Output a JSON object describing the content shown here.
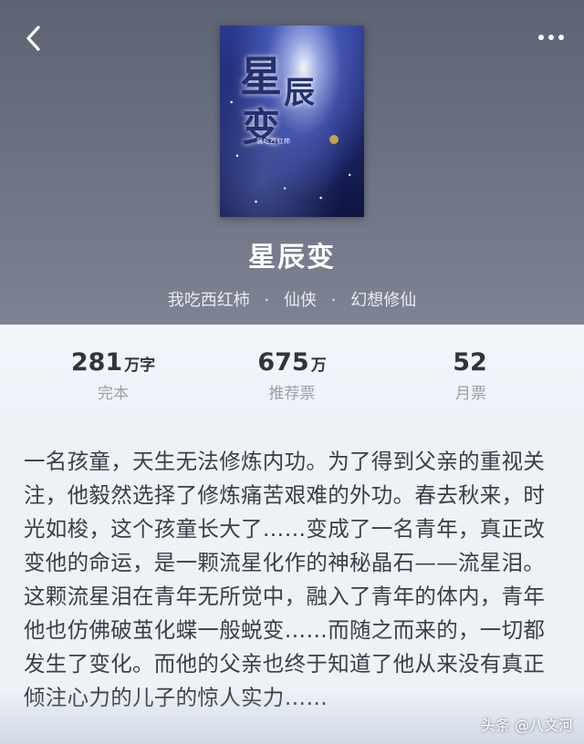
{
  "header": {
    "back_icon": "chevron-left-icon",
    "more_icon": "more-horizontal-icon"
  },
  "cover": {
    "title_chars": [
      "星",
      "辰",
      "变"
    ],
    "author_small": "我吃西红柿"
  },
  "book": {
    "title": "星辰变",
    "author": "我吃西红柿",
    "category": "仙侠",
    "subcategory": "幻想修仙",
    "separator": "·"
  },
  "stats": {
    "words": {
      "value": "281",
      "unit": "万字",
      "label": "完本"
    },
    "recommend": {
      "value": "675",
      "unit": "万",
      "label": "推荐票"
    },
    "monthly": {
      "value": "52",
      "unit": "",
      "label": "月票"
    }
  },
  "description": "一名孩童，天生无法修炼内功。为了得到父亲的重视关注，他毅然选择了修炼痛苦艰难的外功。春去秋来，时光如梭，这个孩童长大了……变成了一名青年，真正改变他的命运，是一颗流星化作的神秘晶石——流星泪。这颗流星泪在青年无所觉中，融入了青年的体内，青年他也仿佛破茧化蝶一般蜕变……而随之而来的，一切都发生了变化。而他的父亲也终于知道了他从来没有真正倾注心力的儿子的惊人实力……",
  "watermark": "头条 @八文河",
  "colors": {
    "header_bg": "#6b7182",
    "body_bg": "#eef1f6",
    "text_primary": "#3a3f48",
    "text_secondary": "#9aa0ab"
  }
}
